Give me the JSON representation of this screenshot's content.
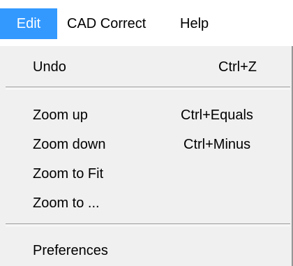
{
  "menubar": {
    "edit": "Edit",
    "cad_correct": "CAD Correct",
    "help": "Help"
  },
  "edit_menu": {
    "undo": {
      "label": "Undo",
      "shortcut": "Ctrl+Z"
    },
    "zoom_up": {
      "label": "Zoom up",
      "shortcut": "Ctrl+Equals"
    },
    "zoom_down": {
      "label": "Zoom down",
      "shortcut": "Ctrl+Minus"
    },
    "zoom_to_fit": {
      "label": "Zoom to Fit"
    },
    "zoom_to": {
      "label": "Zoom to ..."
    },
    "preferences": {
      "label": "Preferences"
    }
  },
  "colors": {
    "active_menu_bg": "#3399ff",
    "menu_bg": "#f0f0f0",
    "menubar_bg": "#ffffff"
  }
}
